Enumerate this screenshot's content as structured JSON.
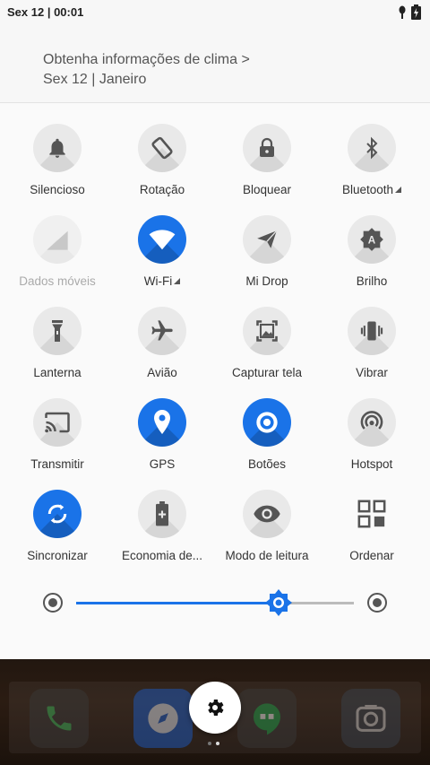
{
  "status_bar": {
    "time": "Sex 12 | 00:01"
  },
  "header": {
    "weather_link": "Obtenha informações de clima >",
    "date": "Sex 12 | Janeiro"
  },
  "tiles": [
    {
      "label": "Silencioso",
      "icon": "bell-icon",
      "active": false
    },
    {
      "label": "Rotação",
      "icon": "rotation-icon",
      "active": false
    },
    {
      "label": "Bloquear",
      "icon": "lock-icon",
      "active": false
    },
    {
      "label": "Bluetooth",
      "icon": "bluetooth-icon",
      "active": false
    },
    {
      "label": "Dados móveis",
      "icon": "mobile-data-icon",
      "active": false
    },
    {
      "label": "Wi-Fi",
      "icon": "wifi-icon",
      "active": true
    },
    {
      "label": "Mi Drop",
      "icon": "paper-plane-icon",
      "active": false
    },
    {
      "label": "Brilho",
      "icon": "auto-brightness-icon",
      "active": false
    },
    {
      "label": "Lanterna",
      "icon": "flashlight-icon",
      "active": false
    },
    {
      "label": "Avião",
      "icon": "airplane-icon",
      "active": false
    },
    {
      "label": "Capturar tela",
      "icon": "screenshot-icon",
      "active": false
    },
    {
      "label": "Vibrar",
      "icon": "vibrate-icon",
      "active": false
    },
    {
      "label": "Transmitir",
      "icon": "cast-icon",
      "active": false
    },
    {
      "label": "GPS",
      "icon": "location-icon",
      "active": true
    },
    {
      "label": "Botões",
      "icon": "buttons-icon",
      "active": true
    },
    {
      "label": "Hotspot",
      "icon": "hotspot-icon",
      "active": false
    },
    {
      "label": "Sincronizar",
      "icon": "sync-icon",
      "active": true
    },
    {
      "label": "Economia de...",
      "icon": "battery-saver-icon",
      "active": false
    },
    {
      "label": "Modo de leitura",
      "icon": "eye-icon",
      "active": false
    },
    {
      "label": "Ordenar",
      "icon": "grid-edit-icon",
      "active": false
    }
  ],
  "brightness": {
    "level_fraction": 0.73
  },
  "colors": {
    "accent": "#1a73e8",
    "tile_bg": "#e9e9e9",
    "icon": "#555555"
  },
  "dock": {
    "apps": [
      "phone-icon",
      "browser-icon",
      "hangouts-icon",
      "camera-icon"
    ],
    "page_count": 2,
    "current_page": 2
  }
}
